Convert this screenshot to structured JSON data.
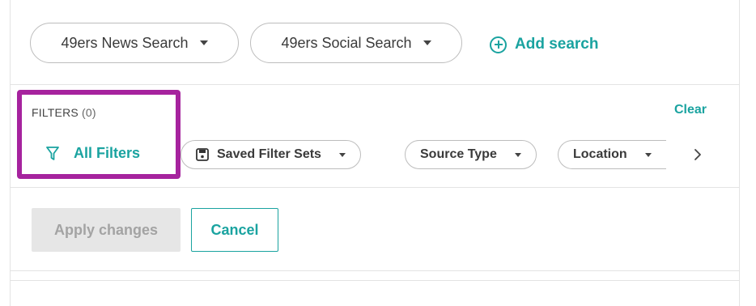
{
  "searches": {
    "items": [
      {
        "label": "49ers News Search"
      },
      {
        "label": "49ers Social Search"
      }
    ],
    "add_label": "Add search"
  },
  "filters": {
    "title": "FILTERS",
    "count": "(0)",
    "clear_label": "Clear",
    "all_filters_label": "All Filters",
    "chips": [
      {
        "label": "Saved Filter Sets"
      },
      {
        "label": "Source Type"
      },
      {
        "label": "Location"
      }
    ],
    "highlight_color": "#a6239e"
  },
  "actions": {
    "apply_label": "Apply changes",
    "cancel_label": "Cancel"
  },
  "colors": {
    "accent": "#1aa3a0",
    "border": "#bdbdbd"
  }
}
